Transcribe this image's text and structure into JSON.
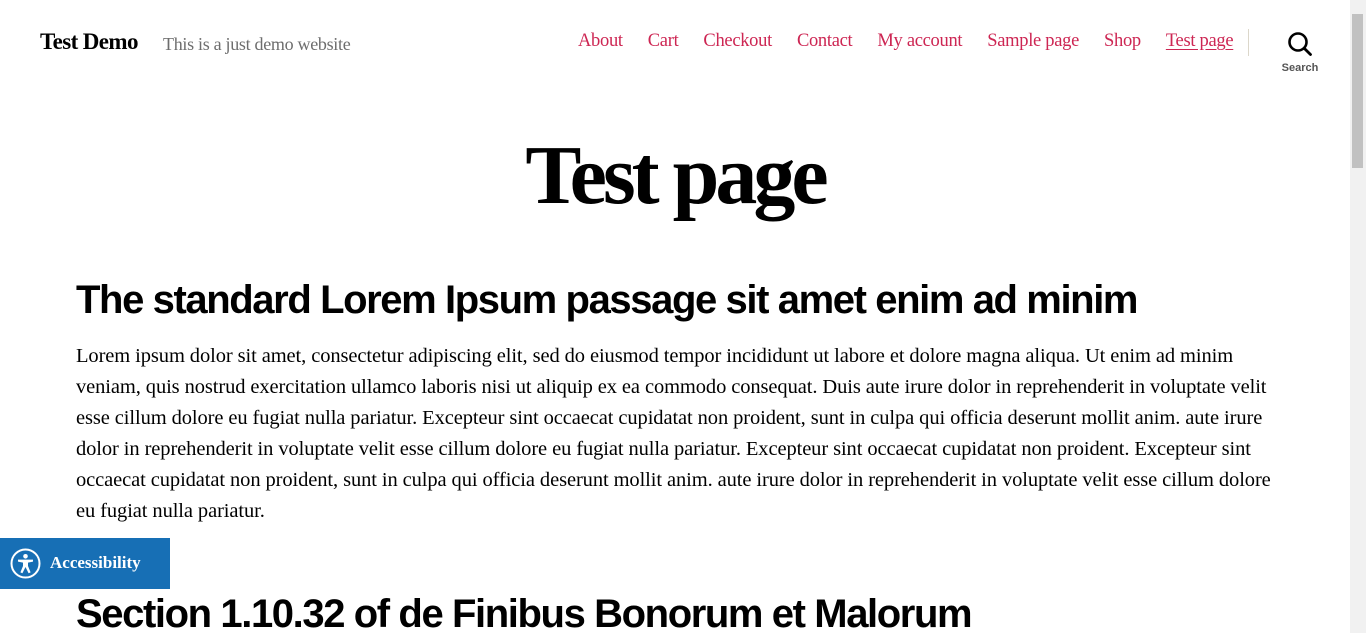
{
  "header": {
    "site_title": "Test Demo",
    "site_description": "This is a just demo website",
    "nav": [
      "About",
      "Cart",
      "Checkout",
      "Contact",
      "My account",
      "Sample page",
      "Shop",
      "Test page"
    ],
    "current_nav": "Test page",
    "search_label": "Search"
  },
  "page": {
    "title": "Test page",
    "sections": [
      {
        "heading": "The standard Lorem Ipsum passage sit amet enim ad minim",
        "body": "Lorem ipsum dolor sit amet, consectetur adipiscing elit, sed do eiusmod tempor incididunt ut labore et dolore magna aliqua. Ut enim ad minim veniam, quis nostrud exercitation ullamco laboris nisi ut aliquip ex ea commodo consequat. Duis aute irure dolor in reprehenderit in voluptate velit esse cillum dolore eu fugiat nulla pariatur. Excepteur sint occaecat cupidatat non proident, sunt in culpa qui officia deserunt mollit anim. aute irure dolor in reprehenderit in voluptate velit esse cillum dolore eu fugiat nulla pariatur. Excepteur sint occaecat cupidatat non proident. Excepteur sint occaecat cupidatat non proident, sunt in culpa qui officia deserunt mollit anim. aute irure dolor in reprehenderit in voluptate velit esse cillum dolore eu fugiat nulla pariatur."
      },
      {
        "heading": "Section 1.10.32 of de Finibus Bonorum et Malorum"
      }
    ]
  },
  "accessibility": {
    "label": "Accessibility",
    "icon": "accessibility-icon"
  },
  "colors": {
    "link": "#cd2653",
    "accessibility_bg": "#176fb5",
    "description_text": "#6d6d6d"
  }
}
